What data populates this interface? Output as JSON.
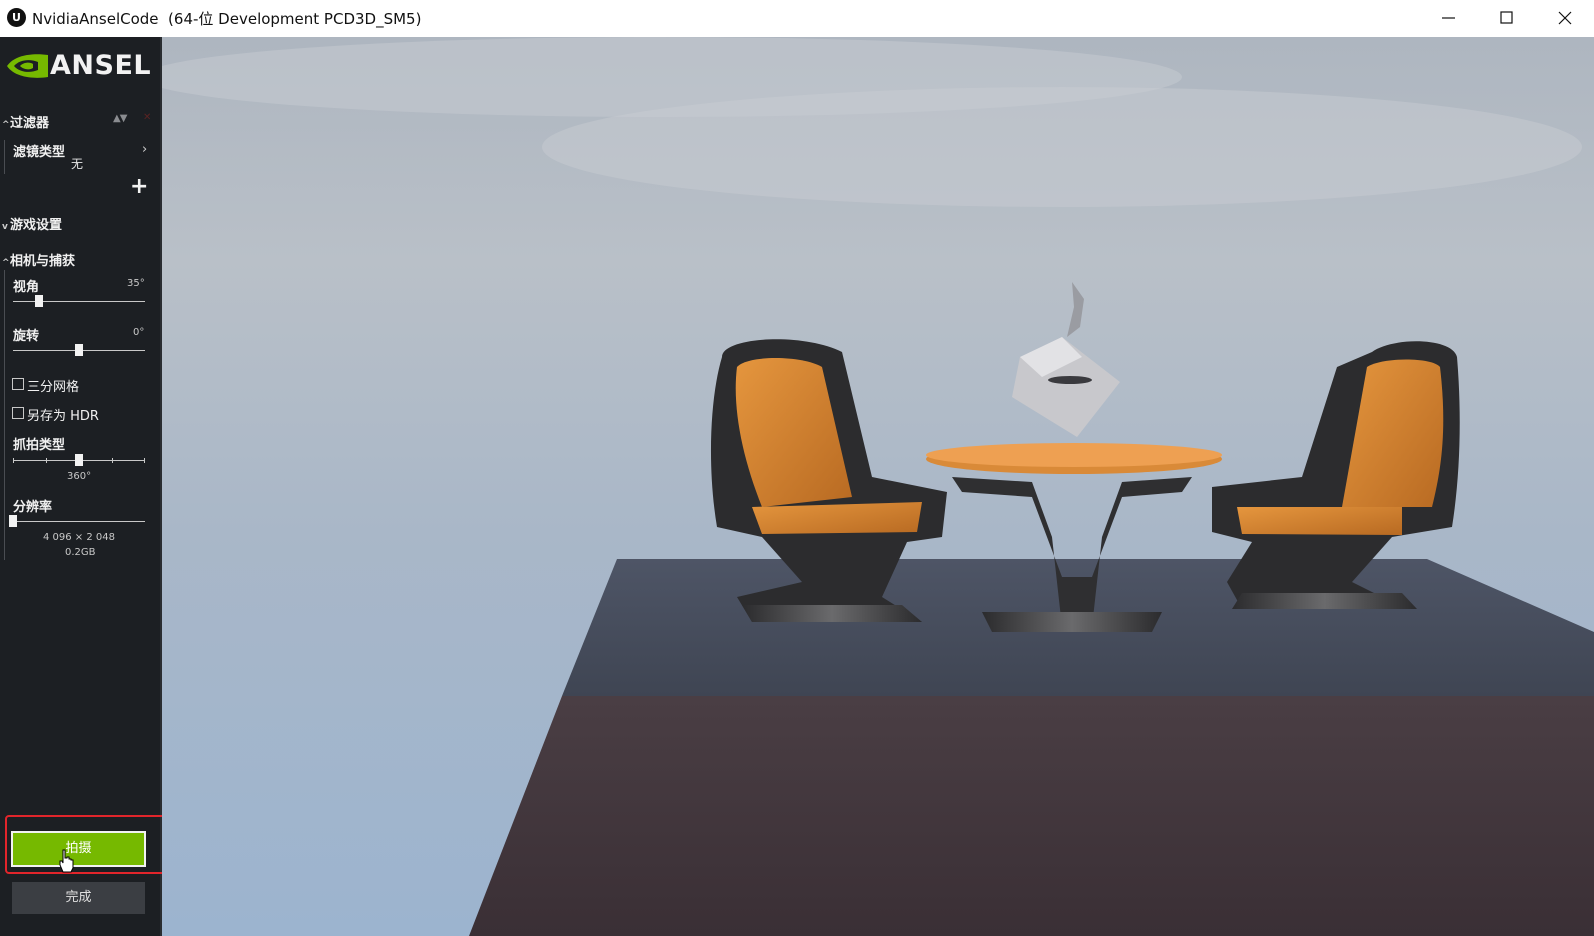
{
  "window": {
    "app_icon_letter": "U",
    "title": "NvidiaAnselCode  (64-位 Development PCD3D_SM5)"
  },
  "ansel": {
    "brand": "ANSEL",
    "filters": {
      "header": "过滤器",
      "filter_type_label": "滤镜类型",
      "filter_type_value": "无",
      "add_label": "+"
    },
    "game_settings": {
      "header": "游戏设置"
    },
    "camera": {
      "header": "相机与捕获",
      "fov_label": "视角",
      "fov_value": "35°",
      "fov_level": 0.2,
      "rotation_label": "旋转",
      "rotation_value": "0°",
      "rotation_level": 0.5,
      "thirds_grid_label": "三分网格",
      "thirds_grid_checked": false,
      "save_hdr_label": "另存为 HDR",
      "save_hdr_checked": false,
      "capture_type_label": "抓拍类型",
      "capture_type_value": "360°",
      "resolution_label": "分辨率",
      "resolution_value": "4 096 × 2 048",
      "resolution_size": "0.2GB"
    },
    "capture_button": "拍摄",
    "done_button": "完成"
  },
  "colors": {
    "sidebar_bg": "#1c1f23",
    "accent_green": "#76b900",
    "highlight_red": "#e2252b"
  }
}
